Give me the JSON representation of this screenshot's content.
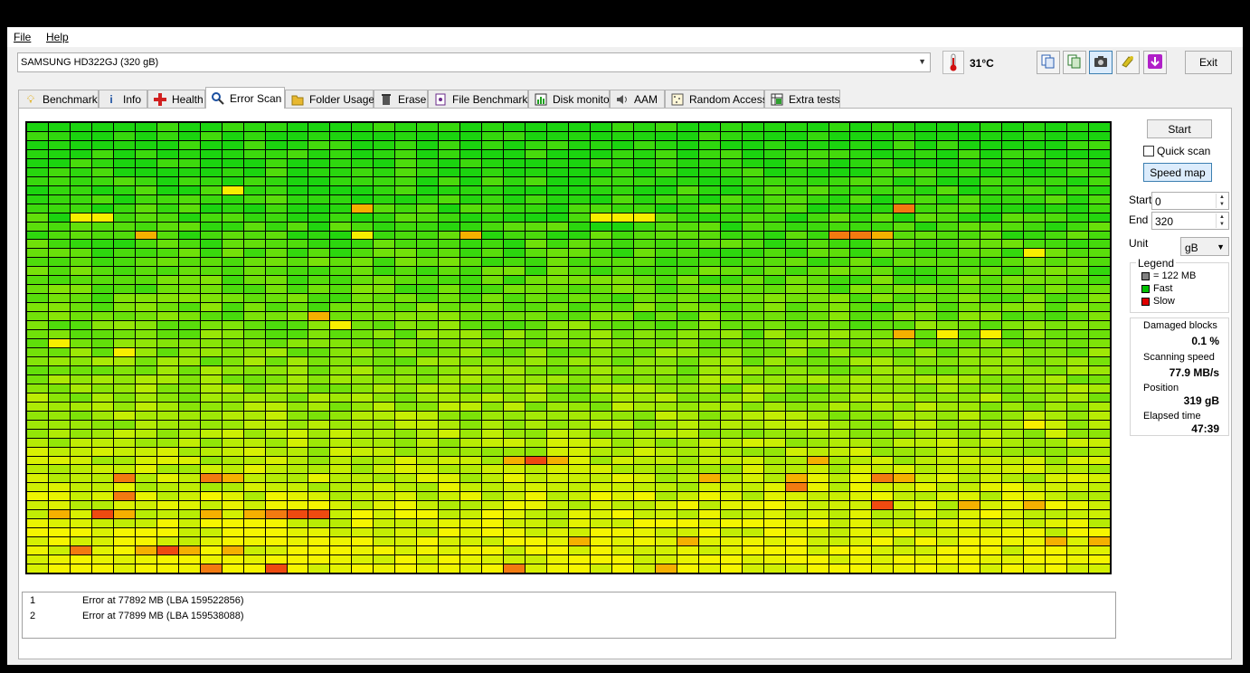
{
  "menu": {
    "file": "File",
    "help": "Help"
  },
  "drive": {
    "selected": "SAMSUNG HD322GJ (320 gB)"
  },
  "temperature": "31°C",
  "toolbar": {
    "icons": [
      "copy-text-icon",
      "copy-image-icon",
      "screenshot-camera-icon",
      "save-tools-icon",
      "download-icon"
    ],
    "exit_label": "Exit"
  },
  "tabs": [
    {
      "label": "Benchmark",
      "icon": "lightbulb-icon"
    },
    {
      "label": "Info",
      "icon": "info-icon"
    },
    {
      "label": "Health",
      "icon": "health-cross-icon"
    },
    {
      "label": "Error Scan",
      "icon": "magnifier-icon",
      "active": true
    },
    {
      "label": "Folder Usage",
      "icon": "folder-icon"
    },
    {
      "label": "Erase",
      "icon": "trash-icon"
    },
    {
      "label": "File Benchmark",
      "icon": "file-benchmark-icon"
    },
    {
      "label": "Disk monitor",
      "icon": "disk-monitor-icon"
    },
    {
      "label": "AAM",
      "icon": "speaker-icon"
    },
    {
      "label": "Random Access",
      "icon": "random-access-icon"
    },
    {
      "label": "Extra tests",
      "icon": "extra-tests-icon"
    }
  ],
  "controls": {
    "start_label": "Start",
    "quick_scan_label": "Quick scan",
    "quick_scan_checked": false,
    "speed_map_label": "Speed map",
    "start_field_label": "Start",
    "start_value": "0",
    "end_field_label": "End",
    "end_value": "320",
    "unit_label": "Unit",
    "unit_value": "gB"
  },
  "legend": {
    "title": "Legend",
    "items": [
      {
        "label": "= 122 MB",
        "color": "#808080"
      },
      {
        "label": "Fast",
        "color": "#00c000"
      },
      {
        "label": "Slow",
        "color": "#e00000"
      }
    ]
  },
  "stats": {
    "damaged_label": "Damaged blocks",
    "damaged_value": "0.1 %",
    "speed_label": "Scanning speed",
    "speed_value": "77.9 MB/s",
    "position_label": "Position",
    "position_value": "319 gB",
    "elapsed_label": "Elapsed time",
    "elapsed_value": "47:39"
  },
  "errors": [
    {
      "n": "1",
      "text": "Error at 77892 MB (LBA 159522856)"
    },
    {
      "n": "2",
      "text": "Error at 77899 MB (LBA 159538088)"
    }
  ],
  "scan_map": {
    "columns": 50,
    "rows": 50,
    "gradient_colors": [
      "#1bd40f",
      "#f5f500"
    ],
    "hot_colors": {
      "Y": "#f8ee00",
      "O": "#f5b000",
      "R": "#f27a10",
      "D": "#ee4a10"
    },
    "hot_cells": [
      [
        7,
        9,
        "Y"
      ],
      [
        9,
        15,
        "O"
      ],
      [
        9,
        40,
        "R"
      ],
      [
        10,
        2,
        "Y"
      ],
      [
        10,
        3,
        "Y"
      ],
      [
        10,
        26,
        "Y"
      ],
      [
        10,
        27,
        "Y"
      ],
      [
        10,
        28,
        "Y"
      ],
      [
        12,
        5,
        "O"
      ],
      [
        12,
        15,
        "Y"
      ],
      [
        12,
        20,
        "O"
      ],
      [
        12,
        37,
        "R"
      ],
      [
        12,
        38,
        "R"
      ],
      [
        12,
        39,
        "O"
      ],
      [
        14,
        46,
        "Y"
      ],
      [
        21,
        13,
        "O"
      ],
      [
        22,
        14,
        "Y"
      ],
      [
        23,
        40,
        "O"
      ],
      [
        23,
        42,
        "Y"
      ],
      [
        23,
        44,
        "Y"
      ],
      [
        24,
        1,
        "Y"
      ],
      [
        25,
        4,
        "Y"
      ],
      [
        33,
        46,
        "Y"
      ],
      [
        37,
        22,
        "O"
      ],
      [
        37,
        23,
        "D"
      ],
      [
        37,
        24,
        "O"
      ],
      [
        37,
        36,
        "O"
      ],
      [
        39,
        4,
        "R"
      ],
      [
        39,
        8,
        "R"
      ],
      [
        39,
        9,
        "O"
      ],
      [
        39,
        31,
        "O"
      ],
      [
        39,
        35,
        "O"
      ],
      [
        39,
        39,
        "R"
      ],
      [
        39,
        40,
        "O"
      ],
      [
        40,
        35,
        "R"
      ],
      [
        41,
        4,
        "R"
      ],
      [
        42,
        39,
        "D"
      ],
      [
        42,
        43,
        "O"
      ],
      [
        42,
        46,
        "O"
      ],
      [
        43,
        1,
        "O"
      ],
      [
        43,
        3,
        "D"
      ],
      [
        43,
        4,
        "O"
      ],
      [
        43,
        8,
        "O"
      ],
      [
        43,
        10,
        "O"
      ],
      [
        43,
        11,
        "R"
      ],
      [
        43,
        12,
        "D"
      ],
      [
        43,
        13,
        "D"
      ],
      [
        46,
        25,
        "O"
      ],
      [
        46,
        30,
        "O"
      ],
      [
        46,
        47,
        "O"
      ],
      [
        46,
        49,
        "O"
      ],
      [
        47,
        2,
        "R"
      ],
      [
        47,
        5,
        "O"
      ],
      [
        47,
        6,
        "D"
      ],
      [
        47,
        7,
        "O"
      ],
      [
        47,
        9,
        "O"
      ],
      [
        49,
        8,
        "R"
      ],
      [
        49,
        11,
        "D"
      ],
      [
        49,
        22,
        "R"
      ],
      [
        49,
        29,
        "O"
      ]
    ]
  }
}
